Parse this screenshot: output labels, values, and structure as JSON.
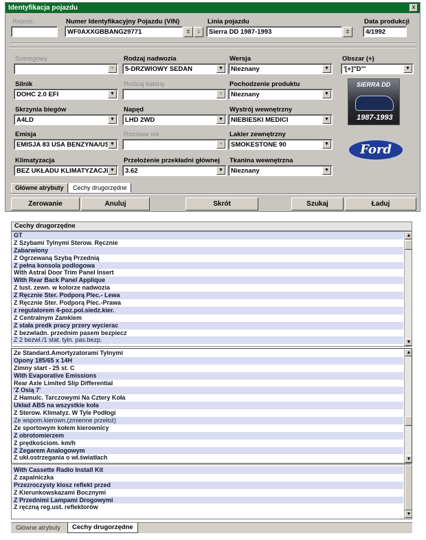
{
  "window": {
    "title": "Identyfikacja pojazdu",
    "close": "x"
  },
  "top_fields": {
    "rejestr_label": "Rejestr.",
    "rejestr_value": "",
    "vin_label": "Numer Identyfikacyjny Pojazdu (VIN)",
    "vin_value": "WF0AXXGBBANG29771",
    "linia_label": "Linia pojazdu",
    "linia_value": "Sierra DD 1987-1993",
    "data_label": "Data produkcji",
    "data_value": "4/1992"
  },
  "attributes": [
    {
      "label": "Szeregowy",
      "value": "",
      "disabled": true
    },
    {
      "label": "Rodzaj nadwozia",
      "value": "5-DRZWIOWY SEDAN",
      "disabled": false
    },
    {
      "label": "Wersja",
      "value": "Nieznany",
      "disabled": false
    },
    {
      "label": "Obszar (+)",
      "value": "'[+]\"D\"'",
      "disabled": false
    },
    {
      "label": "Silnik",
      "value": "DOHC 2.0 EFI",
      "disabled": false
    },
    {
      "label": "Rodzaj kabiny",
      "value": "",
      "disabled": true
    },
    {
      "label": "Pochodzenie produktu",
      "value": "Nieznany",
      "disabled": false
    },
    {
      "label": "Skrzynia biegów",
      "value": "A4LD",
      "disabled": false
    },
    {
      "label": "Napęd",
      "value": "LHD 2WD",
      "disabled": false
    },
    {
      "label": "Wystrój wewnętrzny",
      "value": "NIEBIESKI MEDICI",
      "disabled": false
    },
    {
      "label": "Emisja",
      "value": "EMISJA 83 USA BENZYNA/US",
      "disabled": false
    },
    {
      "label": "Rozstaw osi",
      "value": "",
      "disabled": true
    },
    {
      "label": "Lakier zewnętrzny",
      "value": "SMOKESTONE 90",
      "disabled": false
    },
    {
      "label": "Klimatyzacja",
      "value": "BEZ UKŁADU KLIMATYZACJI",
      "disabled": false
    },
    {
      "label": "Przełożenie przekładni głównej",
      "value": "3.62",
      "disabled": false
    },
    {
      "label": "Tkanina wewnętrzna",
      "value": "Nieznany",
      "disabled": false
    }
  ],
  "car_image": {
    "line1": "SIERRA DD",
    "line2": "1987-1993"
  },
  "ford_logo": "Ford",
  "tabs_top": [
    "Główne atrybuty",
    "Cechy drugorzędne"
  ],
  "buttons": {
    "zerowanie": "Zerowanie",
    "anuluj": "Anuluj",
    "skrot": "Skrót",
    "szukaj": "Szukaj",
    "laduj": "Ładuj"
  },
  "features": {
    "header": "Cechy drugorzędne",
    "list1": [
      "GT",
      "Z Szybami Tylnymi Sterow. Ręcznie",
      "Zabarwiony",
      "Z Ogrzewaną Szybą Przednią",
      "Z pełna konsola podlogowa",
      "With Astral Door Trim Panel Insert",
      "With Rear Back Panel Applique",
      "Z lust. zewn. w kolorze nadwozia",
      "Z Ręcznie Ster. Podporą Plec.- Lewa",
      "Z Ręcznie Ster. Podporą Plec.-Prawa",
      "z regulatorem 4-poz.pol.siedz.kier.",
      "Z Centralnym Zamkiem",
      "Z stała predk pracy przery wycierac",
      "Z bezwladn. przednim pasem bezpiecz",
      "Z 2 bezwl./1 stat. tyln. pas.bezp."
    ],
    "list2": [
      "Ze Standard.Amortyzatorami Tylnymi",
      "Opony 185/65 x 14H",
      "Zimny start - 25 st. C",
      "With Evaporative Emissions",
      "Rear Axle Limited Slip Differential",
      "'Z Osią 7'",
      "Z Hamulc. Tarczowymi Na Cztery Koła",
      "Układ ABS na wszystkie koła",
      "Z Sterow. Klimatyz. W Tyle Podłogi",
      "Ze wspom.kierown.(zmienne przełoż)",
      "Ze sportowym kołem kierownicy",
      "Z obrotomierzem",
      "Z prędkościom. km/h",
      "Z Zegarem Analogowym",
      "Z ukł.ostrzegania o wł.światłach"
    ],
    "list3": [
      "With Cassette Radio Install Kit",
      "Z zapalniczka",
      "Przezroczysty klosz reflekt przed",
      "Z Kierunkowskazami Bocznymi",
      "Z Przednimi Lampami Drogowymi",
      "Z ręczną reg.ust. reflektorów"
    ]
  },
  "tabs_bottom": [
    "Główne atrybuty",
    "Cechy drugorzędne"
  ],
  "scroll": {
    "up": "▲",
    "down": "▼"
  }
}
